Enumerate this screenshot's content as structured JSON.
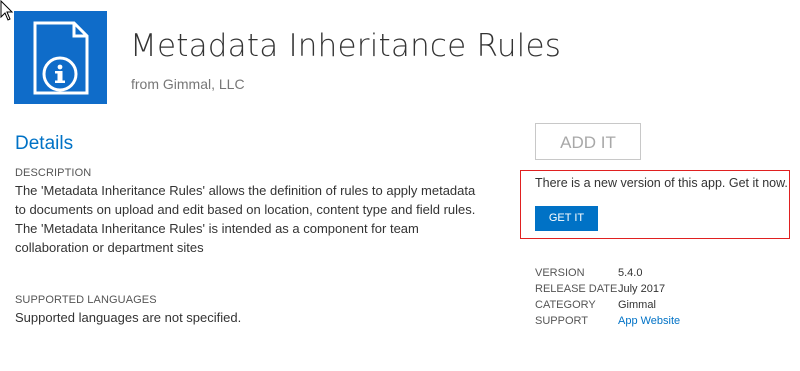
{
  "app": {
    "title": "Metadata Inheritance Rules",
    "publisher": "from Gimmal, LLC",
    "icon": "document-info-icon",
    "icon_color": "#0f6cc9"
  },
  "details": {
    "heading": "Details",
    "description_label": "DESCRIPTION",
    "description_text": "The 'Metadata Inheritance Rules' allows the definition of rules to apply metadata to documents on upload and edit based on location, content type and field rules. The 'Metadata Inheritance Rules' is intended as a component for team collaboration or department sites",
    "languages_label": "SUPPORTED LANGUAGES",
    "languages_text": "Supported languages are not specified."
  },
  "actions": {
    "add_label": "ADD IT",
    "update_message": "There is a new version of this app. Get it now.",
    "get_label": "GET IT",
    "accent_color": "#0072c6",
    "highlight_color": "#e02020"
  },
  "meta": {
    "version_label": "VERSION",
    "version_value": "5.4.0",
    "release_label": "RELEASE DATE",
    "release_value": "July 2017",
    "category_label": "CATEGORY",
    "category_value": "Gimmal",
    "support_label": "SUPPORT",
    "support_value": "App Website"
  }
}
